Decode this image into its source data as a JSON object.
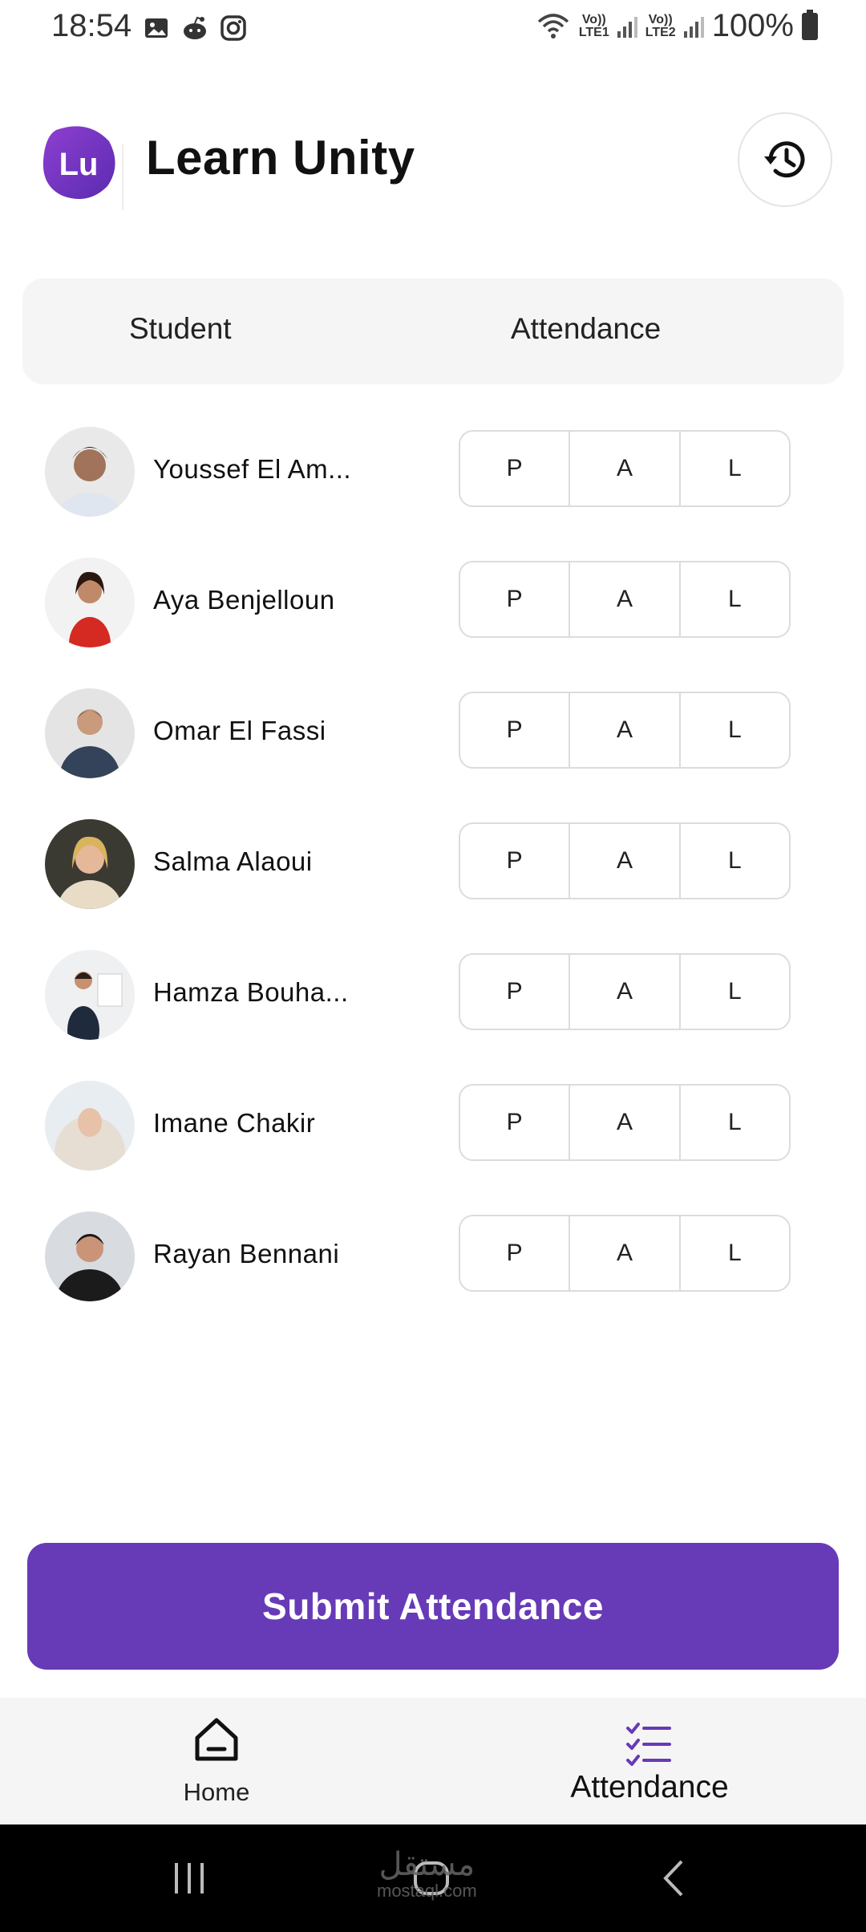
{
  "status_bar": {
    "time": "18:54",
    "battery": "100%",
    "sim1": "LTE1",
    "sim2": "LTE2",
    "volte": "Vo))"
  },
  "header": {
    "logo_text": "Lu",
    "title": "Learn Unity",
    "history_icon": "history-icon"
  },
  "table": {
    "col_student": "Student",
    "col_attendance": "Attendance"
  },
  "students": [
    {
      "name": "Youssef El Am..."
    },
    {
      "name": "Aya Benjelloun"
    },
    {
      "name": "Omar El Fassi"
    },
    {
      "name": "Salma Alaoui"
    },
    {
      "name": "Hamza Bouha..."
    },
    {
      "name": "Imane Chakir"
    },
    {
      "name": "Rayan Bennani"
    }
  ],
  "options": {
    "present": "P",
    "absent": "A",
    "late": "L"
  },
  "submit_label": "Submit Attendance",
  "nav": {
    "home": "Home",
    "attendance": "Attendance"
  },
  "watermark": {
    "line1": "مستقل",
    "line2": "mostaql.com"
  },
  "colors": {
    "accent": "#673ab7",
    "nav_bg": "#f5f5f5"
  }
}
